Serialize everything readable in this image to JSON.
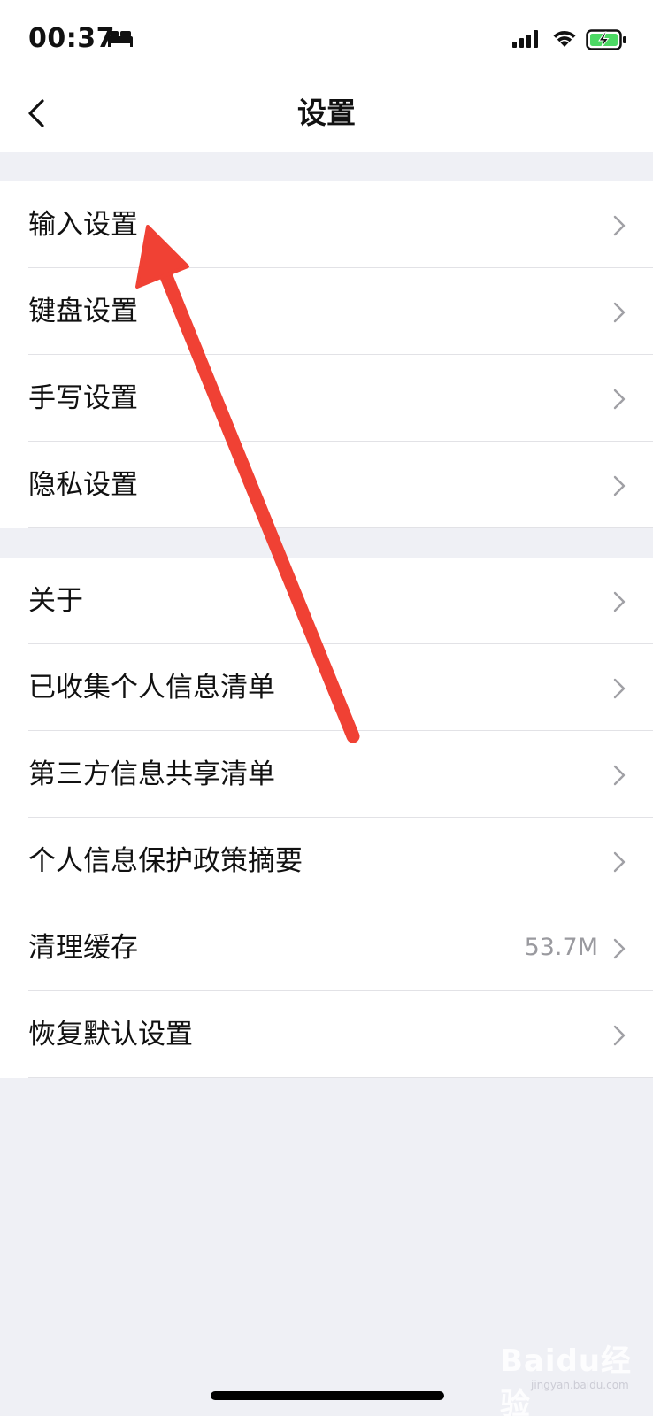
{
  "status_bar": {
    "time": "00:37",
    "icons": [
      "bed-icon",
      "signal-icon",
      "wifi-icon",
      "battery-charging-icon"
    ],
    "battery_color": "#4cd964"
  },
  "nav": {
    "title": "设置",
    "back_icon": "chevron-left-icon"
  },
  "groups": [
    {
      "items": [
        {
          "label": "输入设置"
        },
        {
          "label": "键盘设置"
        },
        {
          "label": "手写设置"
        },
        {
          "label": "隐私设置"
        }
      ]
    },
    {
      "items": [
        {
          "label": "关于"
        },
        {
          "label": "已收集个人信息清单"
        },
        {
          "label": "第三方信息共享清单"
        },
        {
          "label": "个人信息保护政策摘要"
        },
        {
          "label": "清理缓存",
          "value": "53.7M"
        },
        {
          "label": "恢复默认设置"
        }
      ]
    }
  ],
  "annotation": {
    "type": "arrow",
    "color": "#f04134",
    "points_to": "输入设置"
  },
  "watermark": {
    "text": "Baidu经验",
    "sub": "jingyan.baidu.com"
  }
}
